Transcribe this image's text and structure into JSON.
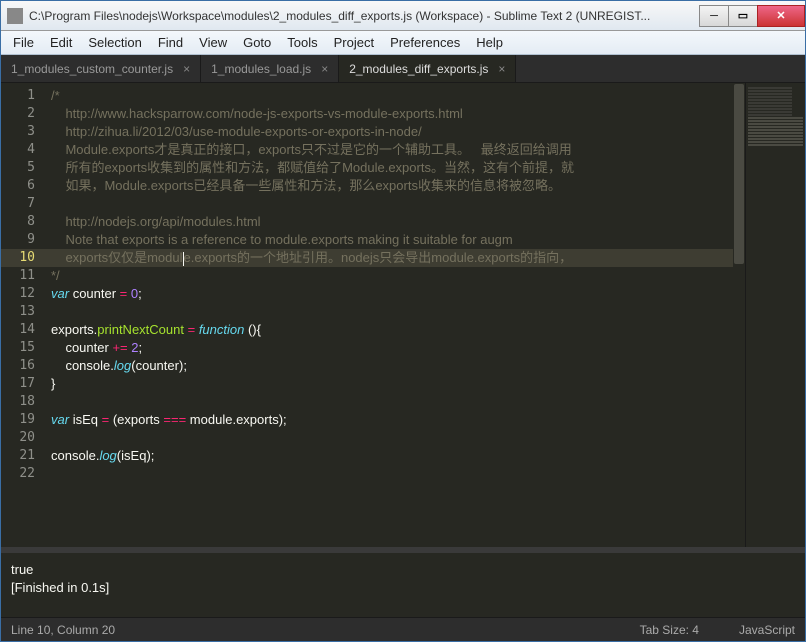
{
  "titlebar": {
    "text": "C:\\Program Files\\nodejs\\Workspace\\modules\\2_modules_diff_exports.js (Workspace) - Sublime Text 2 (UNREGIST..."
  },
  "menu": {
    "file": "File",
    "edit": "Edit",
    "selection": "Selection",
    "find": "Find",
    "view": "View",
    "goto": "Goto",
    "tools": "Tools",
    "project": "Project",
    "preferences": "Preferences",
    "help": "Help"
  },
  "tabs": {
    "t1": "1_modules_custom_counter.js",
    "t2": "1_modules_load.js",
    "t3": "2_modules_diff_exports.js",
    "close": "×"
  },
  "code": {
    "l1": "/*",
    "l2": "    http://www.hacksparrow.com/node-js-exports-vs-module-exports.html",
    "l3": "    http://zihua.li/2012/03/use-module-exports-or-exports-in-node/",
    "l4": "    Module.exports才是真正的接口，exports只不过是它的一个辅助工具。   最终返回给调用",
    "l5": "    所有的exports收集到的属性和方法，都赋值给了Module.exports。当然，这有个前提，就",
    "l6": "    如果，Module.exports已经具备一些属性和方法，那么exports收集来的信息将被忽略。",
    "l7": "",
    "l8": "    http://nodejs.org/api/modules.html",
    "l9": "    Note that exports is a reference to module.exports making it suitable for augm",
    "l10a": "    exports仅仅是modul",
    "l10b": "e.exports的一个地址引用。nodejs只会导出module.exports的指向，",
    "l11": "*/",
    "var": "var",
    "counter": "counter",
    "eq": " = ",
    "zero": "0",
    "semi": ";",
    "exports": "exports",
    "dot": ".",
    "printNextCount": "printNextCount",
    "function": "function",
    "parenempty": " ()",
    "obrace": "{",
    "cbrace": "}",
    "pluseq": " += ",
    "two": "2",
    "consolelog": "console",
    "log": "log",
    "oparen": "(",
    "cparen": ")",
    "isEq": "isEq",
    "tripleeq": " === ",
    "module": "module"
  },
  "console": {
    "l1": "true",
    "l2": "[Finished in 0.1s]"
  },
  "status": {
    "pos": "Line 10, Column 20",
    "tab": "Tab Size: 4",
    "lang": "JavaScript"
  }
}
